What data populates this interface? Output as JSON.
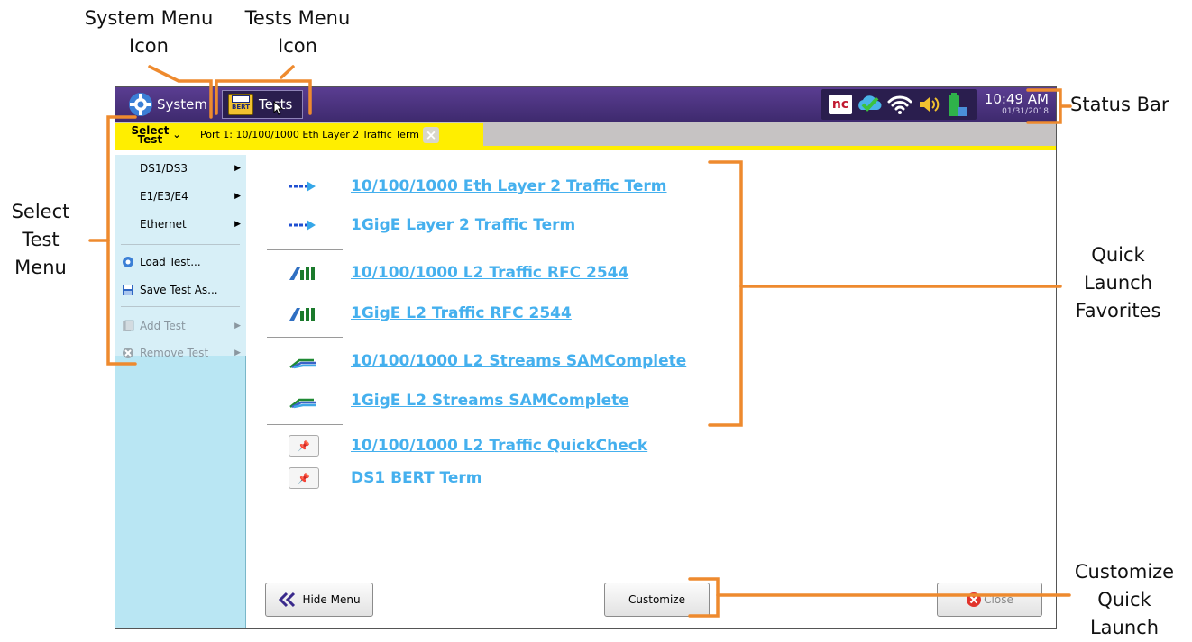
{
  "annotations": {
    "system_menu_icon": [
      "System Menu",
      "Icon"
    ],
    "tests_menu_icon": [
      "Tests Menu",
      "Icon"
    ],
    "status_bar": "Status Bar",
    "select_test_menu": [
      "Select",
      "Test",
      "Menu"
    ],
    "quick_launch_favorites": [
      "Quick",
      "Launch",
      "Favorites"
    ],
    "customize_quick_launch": [
      "Customize",
      "Quick",
      "Launch"
    ],
    "callout_color": "#ee8a2e"
  },
  "topbar": {
    "system_label": "System",
    "tests_label": "Tests",
    "tests_icon_text": "BERT",
    "nc_badge": "nc",
    "time": "10:49 AM",
    "date": "01/31/2018"
  },
  "tabbar": {
    "select_test_line1": "Select",
    "select_test_line2": "Test",
    "port_tab_label": "Port 1: 10/100/1000 Eth Layer 2 Traffic Term"
  },
  "sidebar": {
    "items": [
      {
        "label": "DS1/DS3",
        "has_submenu": true,
        "enabled": true
      },
      {
        "label": "E1/E3/E4",
        "has_submenu": true,
        "enabled": true
      },
      {
        "label": "Ethernet",
        "has_submenu": true,
        "enabled": true
      },
      {
        "label": "Load Test...",
        "icon": "gear-icon",
        "enabled": true
      },
      {
        "label": "Save Test As...",
        "icon": "save-icon",
        "enabled": true
      },
      {
        "label": "Add Test",
        "icon": "add-test-icon",
        "has_submenu": true,
        "enabled": false
      },
      {
        "label": "Remove Test",
        "icon": "remove-icon",
        "has_submenu": true,
        "enabled": false
      }
    ]
  },
  "favorites": [
    {
      "label": "10/100/1000 Eth Layer 2 Traffic Term",
      "icon": "arrow-icon"
    },
    {
      "label": "1GigE Layer 2 Traffic Term",
      "icon": "arrow-icon"
    },
    {
      "label": "10/100/1000 L2 Traffic RFC 2544",
      "icon": "rfc-bars-icon"
    },
    {
      "label": "1GigE L2 Traffic RFC 2544",
      "icon": "rfc-bars-icon"
    },
    {
      "label": "10/100/1000 L2 Streams SAMComplete",
      "icon": "streams-icon"
    },
    {
      "label": "1GigE L2 Streams SAMComplete",
      "icon": "streams-icon"
    },
    {
      "label": "10/100/1000 L2 Traffic QuickCheck",
      "icon": "pin-icon"
    },
    {
      "label": "DS1 BERT Term",
      "icon": "pin-icon"
    }
  ],
  "buttons": {
    "hide_menu": "Hide Menu",
    "customize": "Customize",
    "close": "Close"
  },
  "colors": {
    "topbar": "#4a3380",
    "tab_yellow": "#ffee00",
    "sidebar_blue": "#b9e6f3",
    "link_blue": "#45b0ee"
  }
}
